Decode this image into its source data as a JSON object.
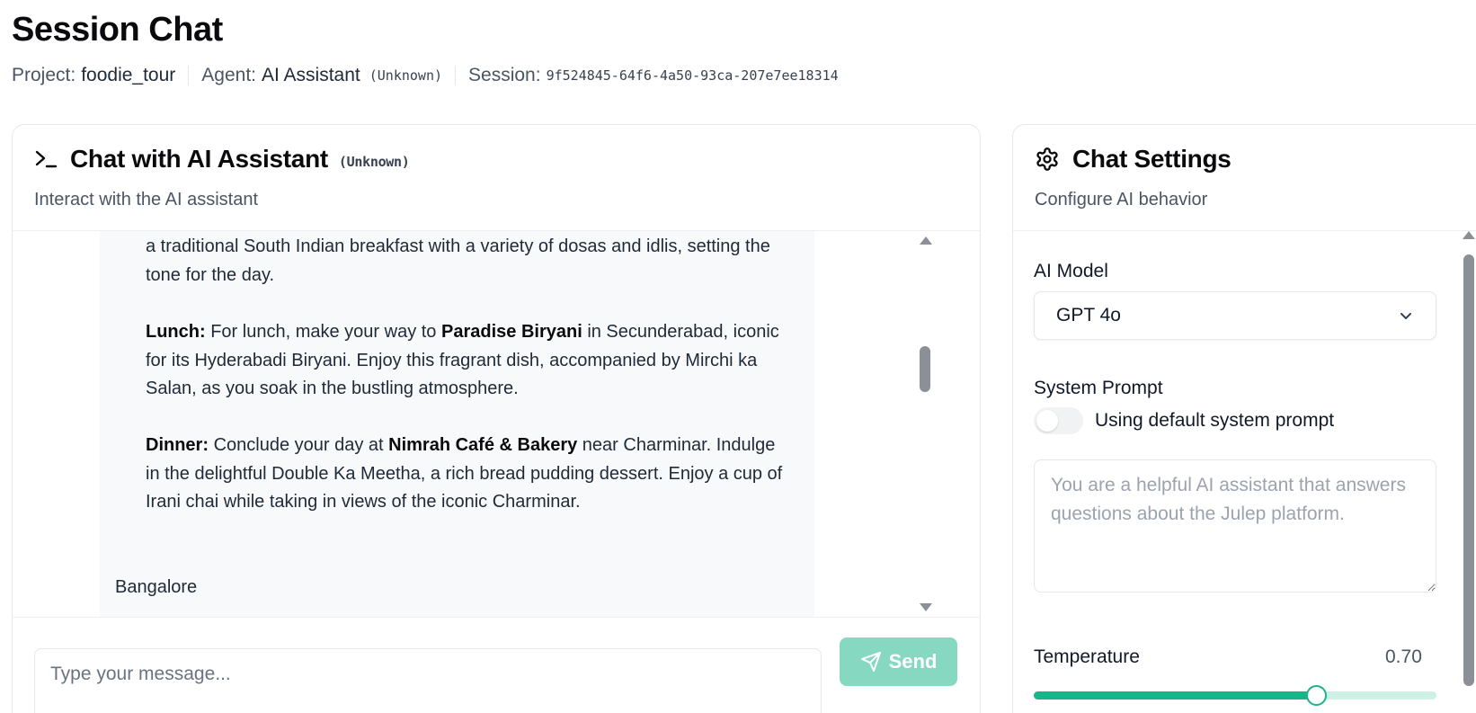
{
  "page": {
    "title": "Session Chat",
    "project_label": "Project:",
    "project_value": "foodie_tour",
    "agent_label": "Agent:",
    "agent_value": "AI Assistant",
    "agent_model": "(Unknown)",
    "session_label": "Session:",
    "session_value": "9f524845-64f6-4a50-93ca-207e7ee18314"
  },
  "chat": {
    "icon": "terminal-icon",
    "title": "Chat with AI Assistant",
    "model_badge": "(Unknown)",
    "subtitle": "Interact with the AI assistant",
    "message": {
      "intro": "a traditional South Indian breakfast with a variety of dosas and idlis, setting the tone for the day.",
      "lunch_label": "Lunch:",
      "lunch_pre": "For lunch, make your way to",
      "lunch_place": "Paradise Biryani",
      "lunch_post": "in Secunderabad, iconic for its Hyderabadi Biryani. Enjoy this fragrant dish, accompanied by Mirchi ka Salan, as you soak in the bustling atmosphere.",
      "dinner_label": "Dinner:",
      "dinner_pre": "Conclude your day at",
      "dinner_place": "Nimrah Café & Bakery",
      "dinner_post": "near Charminar. Indulge in the delightful Double Ka Meetha, a rich bread pudding dessert. Enjoy a cup of Irani chai while taking in views of the iconic Charminar."
    },
    "next_message": "Bangalore",
    "input_placeholder": "Type your message...",
    "send_label": "Send",
    "send_icon": "paper-plane-icon",
    "send_color": "#86d9c0"
  },
  "settings": {
    "icon": "gear-icon",
    "title": "Chat Settings",
    "subtitle": "Configure AI behavior",
    "model_label": "AI Model",
    "model_value": "GPT 4o",
    "system_prompt_label": "System Prompt",
    "toggle_label": "Using default system prompt",
    "toggle_on": false,
    "prompt_placeholder": "You are a helpful AI assistant that answers questions about the Julep platform.",
    "temperature_label": "Temperature",
    "temperature_value": "0.70",
    "temperature_fraction": 0.7,
    "accent_color": "#19b489"
  },
  "scrollbars": {
    "chat_thumb_position": 0.32,
    "chat_thumb_fraction": 0.13
  }
}
